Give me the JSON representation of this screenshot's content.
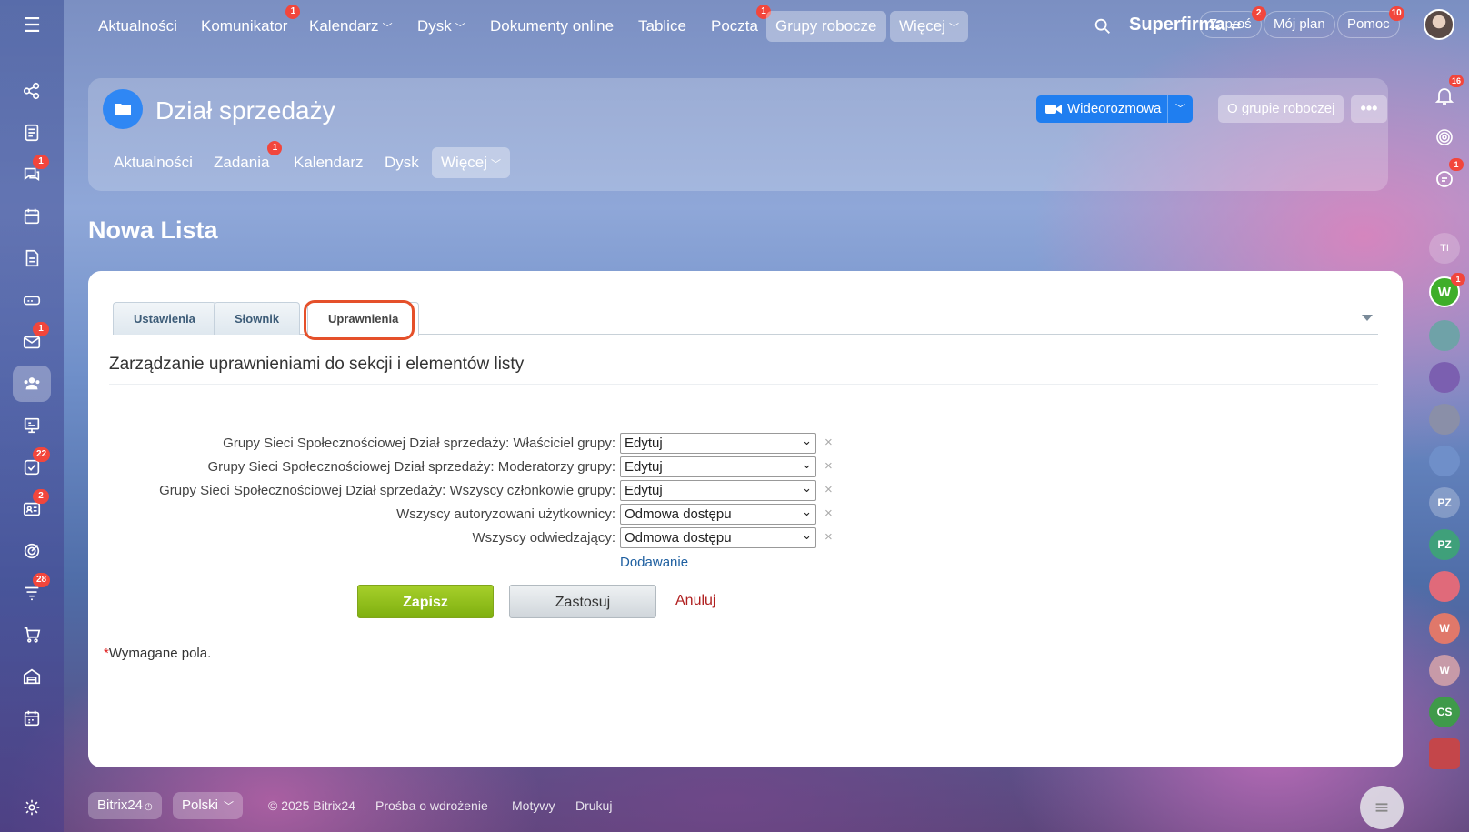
{
  "topnav": {
    "items": [
      {
        "label": "Aktualności",
        "badge": ""
      },
      {
        "label": "Komunikator",
        "badge": "1"
      },
      {
        "label": "Kalendarz",
        "badge": ""
      },
      {
        "label": "Dysk",
        "badge": ""
      },
      {
        "label": "Dokumenty online",
        "badge": ""
      },
      {
        "label": "Tablice",
        "badge": ""
      },
      {
        "label": "Poczta",
        "badge": "1"
      },
      {
        "label": "Grupy robocze",
        "badge": ""
      },
      {
        "label": "Więcej",
        "badge": ""
      }
    ],
    "company": "Superfirma",
    "invite": {
      "label": "Zaproś",
      "badge": "2"
    },
    "plan": "Mój plan",
    "help": {
      "label": "Pomoc",
      "badge": "10"
    }
  },
  "left_sidebar": {
    "badges": {
      "chat": "1",
      "mail": "1",
      "tasks": "22",
      "crm": "2",
      "sales": "28"
    }
  },
  "right_sidebar": {
    "notifications_badge": "16",
    "chat_badge": "1",
    "w_badge": "1",
    "avatars": [
      "TI",
      "W",
      "PZ",
      "PZ",
      "W",
      "W",
      "CS"
    ]
  },
  "group": {
    "title": "Dział sprzedaży",
    "video_label": "Wideorozmowa",
    "about_label": "O grupie roboczej",
    "more_label": "•••",
    "tabs": [
      {
        "label": "Aktualności",
        "badge": ""
      },
      {
        "label": "Zadania",
        "badge": "1"
      },
      {
        "label": "Kalendarz",
        "badge": ""
      },
      {
        "label": "Dysk",
        "badge": ""
      },
      {
        "label": "Więcej",
        "badge": ""
      }
    ]
  },
  "page": {
    "title": "Nowa Lista"
  },
  "form": {
    "tabs": [
      "Ustawienia",
      "Słownik",
      "Uprawnienia"
    ],
    "active_tab": "Uprawnienia",
    "section_title": "Zarządzanie uprawnieniami do sekcji i elementów listy",
    "permissions": [
      {
        "label": "Grupy Sieci Społecznościowej Dział sprzedaży: Właściciel grupy:",
        "value": "Edytuj"
      },
      {
        "label": "Grupy Sieci Społecznościowej Dział sprzedaży: Moderatorzy grupy:",
        "value": "Edytuj"
      },
      {
        "label": "Grupy Sieci Społecznościowej Dział sprzedaży: Wszyscy członkowie grupy:",
        "value": "Edytuj"
      },
      {
        "label": "Wszyscy autoryzowani użytkownicy:",
        "value": "Odmowa dostępu"
      },
      {
        "label": "Wszyscy odwiedzający:",
        "value": "Odmowa dostępu"
      }
    ],
    "remove_symbol": "×",
    "add_label": "Dodawanie",
    "save_label": "Zapisz",
    "apply_label": "Zastosuj",
    "cancel_label": "Anuluj",
    "required_star": "*",
    "required_text": "Wymagane pola."
  },
  "footer": {
    "brand": "Bitrix24",
    "language": "Polski",
    "copyright": "© 2025 Bitrix24",
    "request": "Prośba o wdrożenie",
    "themes": "Motywy",
    "print": "Drukuj"
  },
  "colors": {
    "accent": "#2f87f4",
    "save": "#8dbf1a",
    "badge": "#f2463c",
    "highlight": "#e5502a"
  }
}
